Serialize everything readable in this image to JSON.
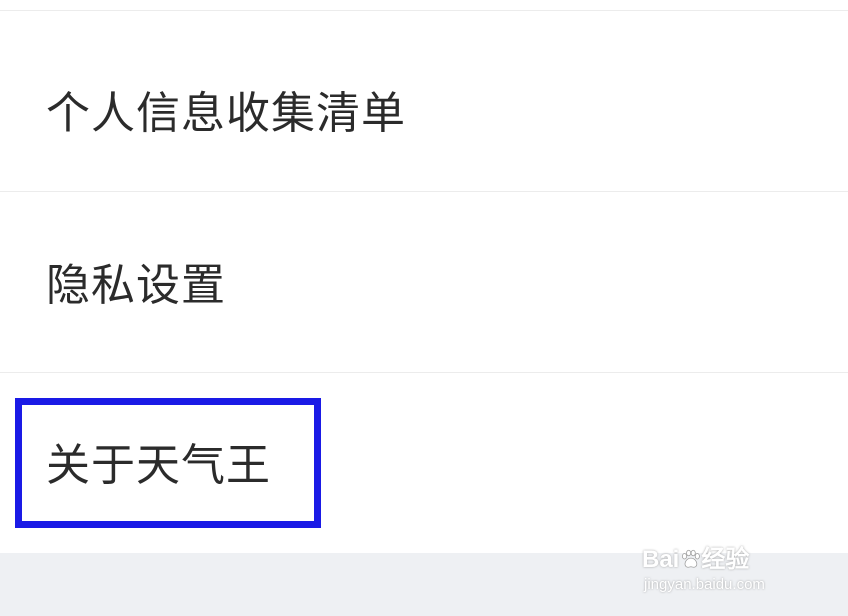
{
  "menu": {
    "items": [
      {
        "label": "个人信息收集清单"
      },
      {
        "label": "隐私设置"
      },
      {
        "label": "关于天气王"
      }
    ]
  },
  "highlight": {
    "color": "#1a1ae6"
  },
  "watermark": {
    "brand_prefix": "Bai",
    "brand_suffix": "经验",
    "url": "jingyan.baidu.com"
  },
  "colors": {
    "text": "#2b2b2b",
    "divider": "#ececec",
    "footer_bg": "#eef0f3",
    "highlight_border": "#1a1ae6"
  }
}
